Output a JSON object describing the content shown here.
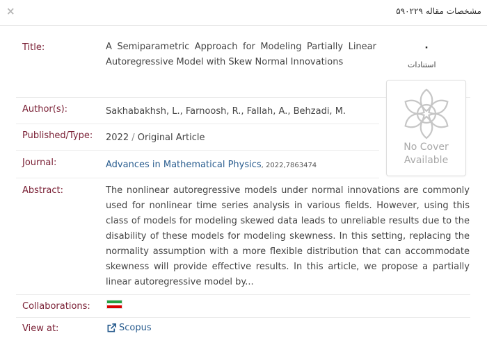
{
  "header": {
    "title": "مشخصات مقاله ۵۹۰۲۲۹",
    "close_glyph": "×"
  },
  "fields": {
    "title_label": "Title:",
    "title_value": "A Semiparametric Approach for Modeling Partially Linear Autoregressive Model with Skew Normal Innovations",
    "authors_label": "Author(s):",
    "authors_value": "Sakhabakhsh, L., Farnoosh, R., Fallah, A., Behzadi, M.",
    "published_label": "Published/Type:",
    "published_year": "2022",
    "published_sep": "/",
    "published_type": "Original Article",
    "journal_label": "Journal:",
    "journal_name": "Advances in Mathematical Physics",
    "journal_extra": ", 2022,7863474",
    "abstract_label": "Abstract:",
    "abstract_value": "The nonlinear autoregressive models under normal innovations are commonly used for nonlinear time series analysis in various fields. However, using this class of models for modeling skewed data leads to unreliable results due to the disability of these models for modeling skewness. In this setting, replacing the normality assumption with a more flexible distribution that can accommodate skewness will provide effective results. In this article, we propose a partially linear autoregressive model by...",
    "collab_label": "Collaborations:",
    "view_label": "View at:",
    "view_link": "Scopus"
  },
  "citations": {
    "count": "۰",
    "label": "استنادات"
  },
  "cover": {
    "line1": "No Cover",
    "line2": "Available"
  },
  "colors": {
    "label": "#7a2035",
    "link": "#2a5d8f",
    "flag_green": "#239f40",
    "flag_white": "#ffffff",
    "flag_red": "#da0000"
  },
  "icons": {
    "close": "close-icon",
    "flag": "iran-flag-icon",
    "external": "external-link-icon",
    "cover": "flower-placeholder-icon"
  }
}
